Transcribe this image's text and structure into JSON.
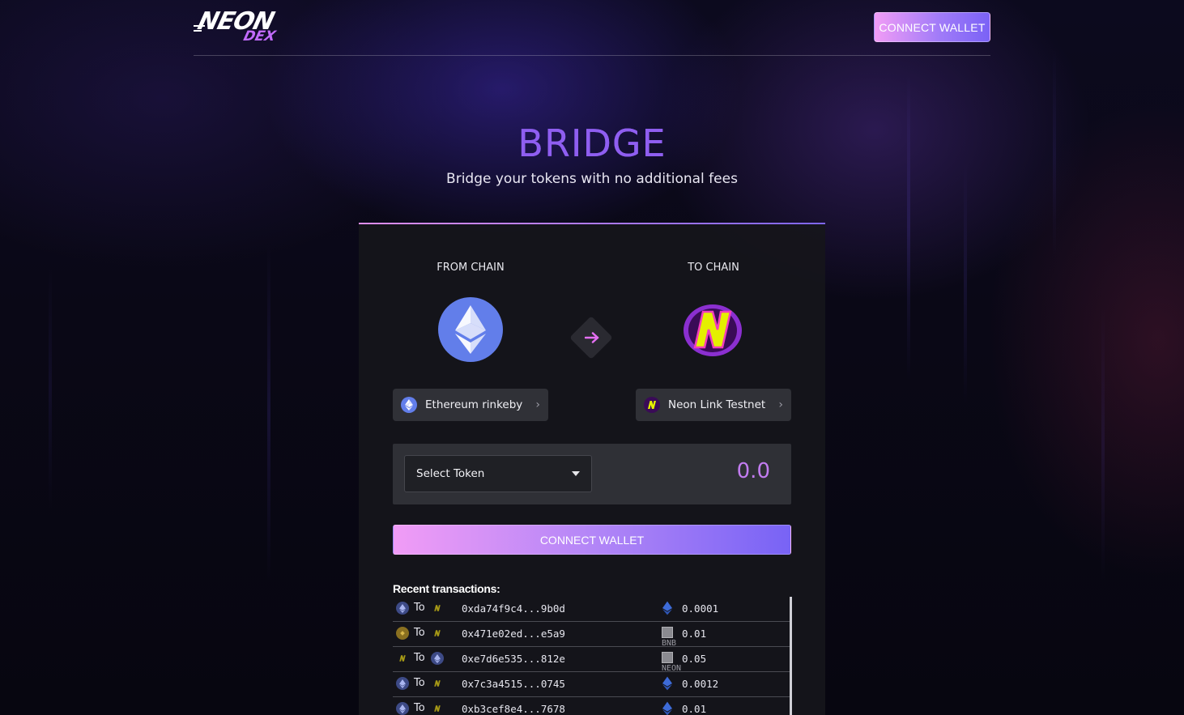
{
  "brand": {
    "logo_main": "NEON",
    "logo_sub": "DEX",
    "accent_color": "#8f5ef1",
    "gradient_start": "#f19cf6",
    "gradient_end": "#7a62f6"
  },
  "header": {
    "connect_wallet_label": "CONNECT WALLET"
  },
  "hero": {
    "title": "BRIDGE",
    "subtitle": "Bridge your tokens with no additional fees"
  },
  "bridge": {
    "from_label": "FROM CHAIN",
    "to_label": "TO CHAIN",
    "from_chain": {
      "name": "Ethereum rinkeby",
      "icon": "ethereum-icon",
      "color": "#627eea"
    },
    "to_chain": {
      "name": "Neon Link Testnet",
      "icon": "neon-icon",
      "color": "#e4f000"
    },
    "swap_icon": "arrow-right-icon",
    "token_select_label": "Select Token",
    "amount_value": "0.0",
    "connect_wallet_label": "CONNECT WALLET"
  },
  "recent": {
    "title": "Recent transactions:",
    "to_word": "To",
    "rows": [
      {
        "from": "ethereum",
        "to": "neon",
        "hash": "0xda74f9c4...9b0d",
        "asset": "ethereum",
        "asset_alt": "",
        "amount": "0.0001"
      },
      {
        "from": "bnb",
        "to": "neon",
        "hash": "0x471e02ed...e5a9",
        "asset": "broken",
        "asset_alt": "BNB",
        "amount": "0.01"
      },
      {
        "from": "neon",
        "to": "ethereum",
        "hash": "0xe7d6e535...812e",
        "asset": "broken",
        "asset_alt": "NEON",
        "amount": "0.05"
      },
      {
        "from": "ethereum",
        "to": "neon",
        "hash": "0x7c3a4515...0745",
        "asset": "ethereum",
        "asset_alt": "",
        "amount": "0.0012"
      },
      {
        "from": "ethereum",
        "to": "neon",
        "hash": "0xb3cef8e4...7678",
        "asset": "ethereum",
        "asset_alt": "",
        "amount": "0.01"
      }
    ]
  }
}
